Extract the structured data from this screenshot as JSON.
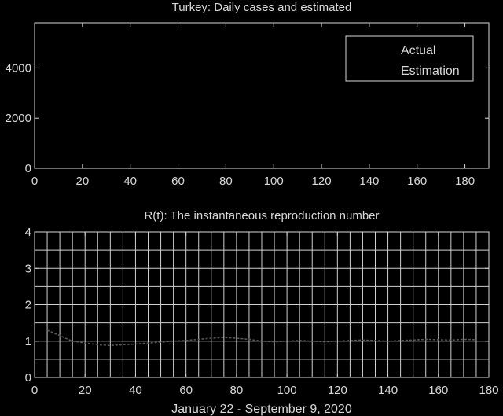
{
  "chart_data": [
    {
      "type": "line",
      "title": "Turkey: Daily cases and estimated",
      "xlabel": "",
      "ylabel": "",
      "xlim": [
        0,
        190
      ],
      "ylim": [
        0,
        5800
      ],
      "xticks": [
        0,
        20,
        40,
        60,
        80,
        100,
        120,
        140,
        160,
        180
      ],
      "yticks": [
        0,
        2000,
        4000
      ],
      "grid": false,
      "legend": {
        "placement": "top-right",
        "entries": [
          "Actual",
          "Estimation"
        ]
      },
      "series": [
        {
          "name": "Actual",
          "values": []
        },
        {
          "name": "Estimation",
          "values": []
        }
      ]
    },
    {
      "type": "line",
      "title": "R(t): The instantaneous reproduction number",
      "xlabel": "January 22 - September 9, 2020",
      "ylabel": "",
      "xlim": [
        0,
        180
      ],
      "ylim": [
        0,
        4
      ],
      "xticks": [
        0,
        20,
        40,
        60,
        80,
        100,
        120,
        140,
        160,
        180
      ],
      "yticks": [
        0,
        1,
        2,
        3,
        4
      ],
      "grid": true,
      "grid_x_step": 5,
      "grid_y_step": 0.5,
      "series": [
        {
          "x": [
            5,
            10,
            15,
            20,
            25,
            30,
            35,
            40,
            45,
            50,
            55,
            60,
            65,
            70,
            75,
            80,
            85,
            90,
            95,
            100,
            105,
            110,
            115,
            120,
            125,
            130,
            135,
            140,
            145,
            150,
            155,
            160,
            165,
            170,
            175
          ],
          "values": [
            1.3,
            1.15,
            1.0,
            0.95,
            0.9,
            0.88,
            0.9,
            0.92,
            0.95,
            0.97,
            1.0,
            1.02,
            1.05,
            1.08,
            1.1,
            1.08,
            1.05,
            1.0,
            0.98,
            1.0,
            1.02,
            1.0,
            0.98,
            1.0,
            1.02,
            1.03,
            1.02,
            1.0,
            1.02,
            1.03,
            1.05,
            1.04,
            1.03,
            1.05,
            1.04
          ]
        }
      ]
    }
  ]
}
